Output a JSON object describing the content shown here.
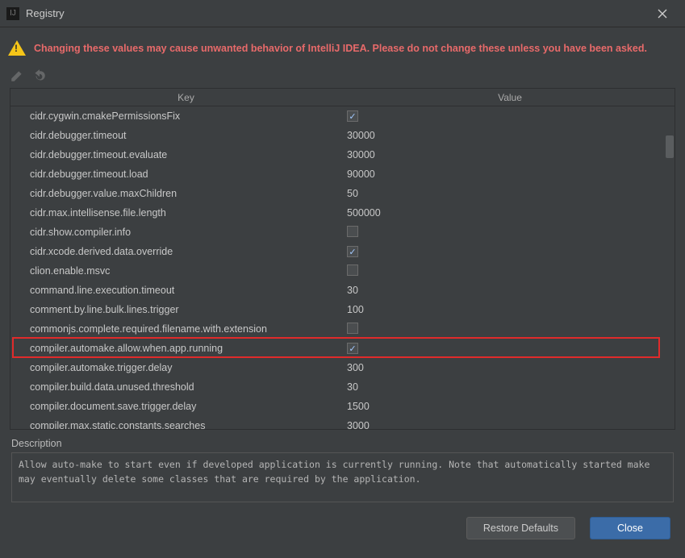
{
  "window": {
    "title": "Registry"
  },
  "warning": {
    "text": "Changing these values may cause unwanted behavior of IntelliJ IDEA. Please do not change these unless you have been asked."
  },
  "table": {
    "columns": {
      "key": "Key",
      "value": "Value"
    },
    "rows": [
      {
        "key": "cidr.cygwin.cmakePermissionsFix",
        "type": "bool",
        "checked": true
      },
      {
        "key": "cidr.debugger.timeout",
        "type": "text",
        "value": "30000"
      },
      {
        "key": "cidr.debugger.timeout.evaluate",
        "type": "text",
        "value": "30000"
      },
      {
        "key": "cidr.debugger.timeout.load",
        "type": "text",
        "value": "90000"
      },
      {
        "key": "cidr.debugger.value.maxChildren",
        "type": "text",
        "value": "50"
      },
      {
        "key": "cidr.max.intellisense.file.length",
        "type": "text",
        "value": "500000"
      },
      {
        "key": "cidr.show.compiler.info",
        "type": "bool",
        "checked": false
      },
      {
        "key": "cidr.xcode.derived.data.override",
        "type": "bool",
        "checked": true
      },
      {
        "key": "clion.enable.msvc",
        "type": "bool",
        "checked": false
      },
      {
        "key": "command.line.execution.timeout",
        "type": "text",
        "value": "30"
      },
      {
        "key": "comment.by.line.bulk.lines.trigger",
        "type": "text",
        "value": "100"
      },
      {
        "key": "commonjs.complete.required.filename.with.extension",
        "type": "bool",
        "checked": false
      },
      {
        "key": "compiler.automake.allow.when.app.running",
        "type": "bool",
        "checked": true,
        "highlighted": true
      },
      {
        "key": "compiler.automake.trigger.delay",
        "type": "text",
        "value": "300"
      },
      {
        "key": "compiler.build.data.unused.threshold",
        "type": "text",
        "value": "30"
      },
      {
        "key": "compiler.document.save.trigger.delay",
        "type": "text",
        "value": "1500"
      },
      {
        "key": "compiler.max.static.constants.searches",
        "type": "text",
        "value": "3000"
      }
    ]
  },
  "description": {
    "label": "Description",
    "text": "Allow auto-make to start even if developed application is currently running. Note that automatically started make may eventually delete some classes that are required by the application."
  },
  "footer": {
    "restore": "Restore Defaults",
    "close": "Close"
  }
}
